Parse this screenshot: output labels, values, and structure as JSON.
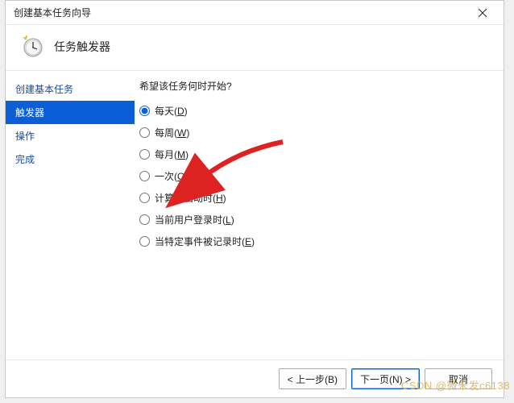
{
  "window": {
    "title": "创建基本任务向导"
  },
  "header": {
    "title": "任务触发器"
  },
  "sidebar": {
    "items": [
      {
        "label": "创建基本任务",
        "active": false
      },
      {
        "label": "触发器",
        "active": true
      },
      {
        "label": "操作",
        "active": false
      },
      {
        "label": "完成",
        "active": false
      }
    ]
  },
  "content": {
    "prompt": "希望该任务何时开始?",
    "options": [
      {
        "label": "每天(",
        "key": "D",
        "suffix": ")",
        "selected": true
      },
      {
        "label": "每周(",
        "key": "W",
        "suffix": ")",
        "selected": false
      },
      {
        "label": "每月(",
        "key": "M",
        "suffix": ")",
        "selected": false
      },
      {
        "label": "一次(",
        "key": "O",
        "suffix": ")",
        "selected": false
      },
      {
        "label": "计算机启动时(",
        "key": "H",
        "suffix": ")",
        "selected": false
      },
      {
        "label": "当前用户登录时(",
        "key": "L",
        "suffix": ")",
        "selected": false
      },
      {
        "label": "当特定事件被记录时(",
        "key": "E",
        "suffix": ")",
        "selected": false
      }
    ]
  },
  "footer": {
    "back": "< 上一步(B)",
    "next": "下一页(N) >",
    "cancel": "取消"
  },
  "watermark": "CSDN @微米发c6138"
}
